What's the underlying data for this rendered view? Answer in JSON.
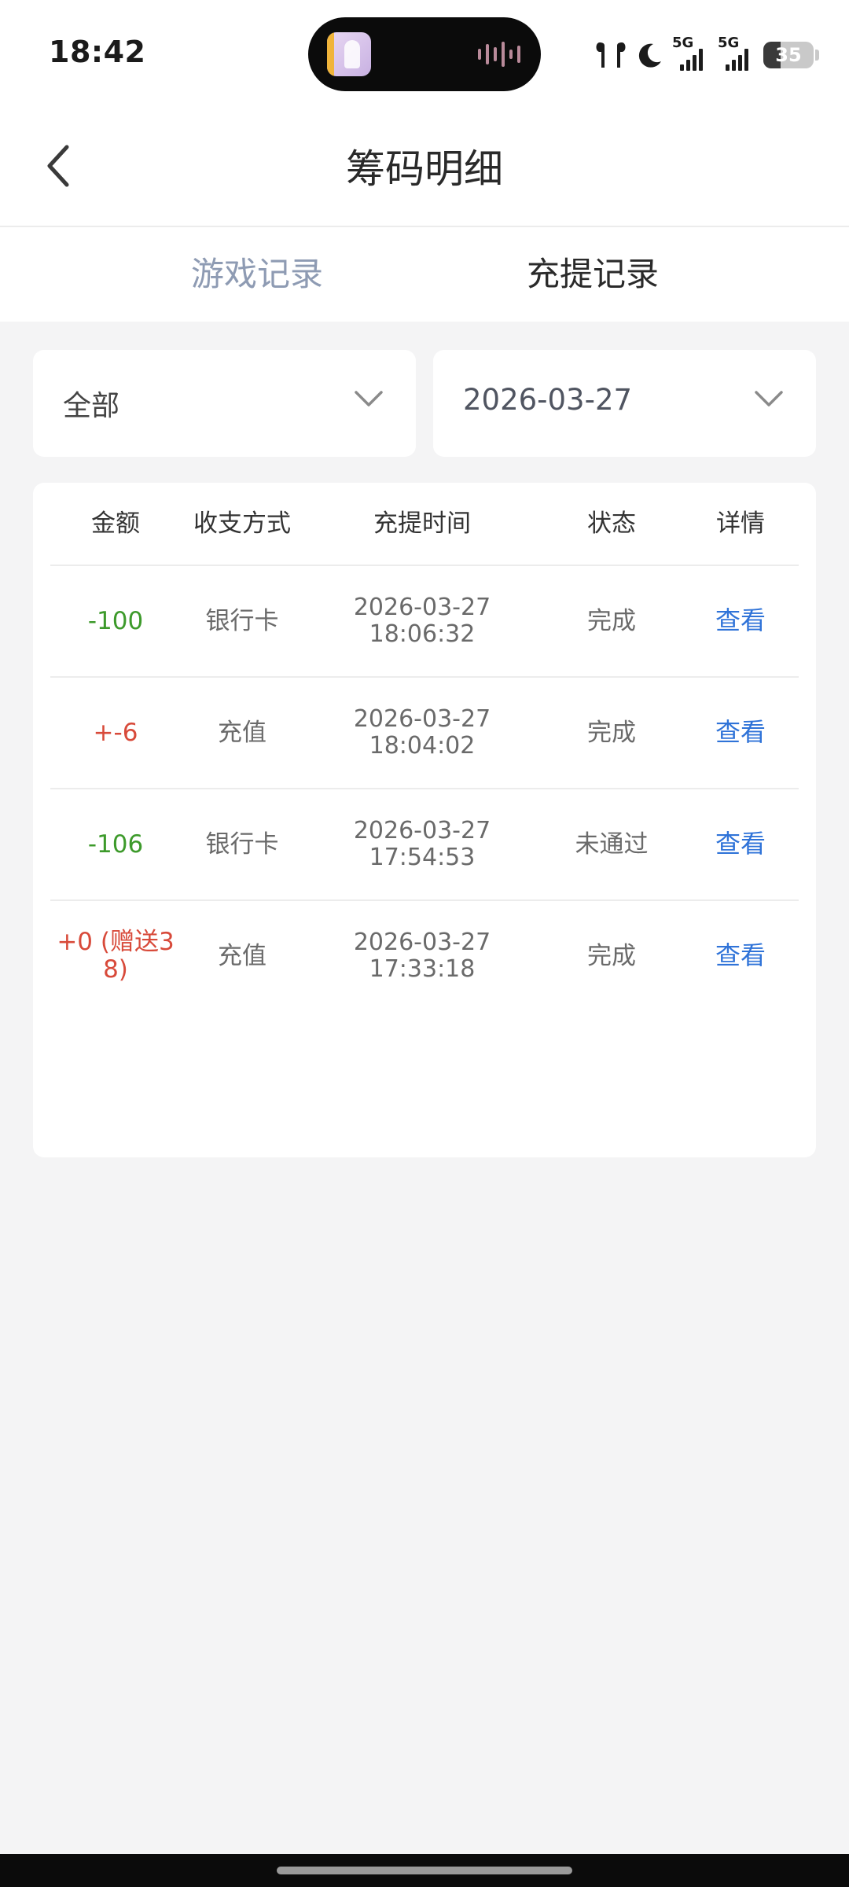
{
  "status_bar": {
    "time": "18:42",
    "network_1": "5G",
    "network_2": "5G",
    "battery": "35",
    "battery_level": 0.35
  },
  "nav": {
    "title": "筹码明细"
  },
  "tabs": {
    "game": "游戏记录",
    "recharge": "充提记录",
    "active": "recharge"
  },
  "filters": {
    "type_value": "全部",
    "date_value": "2026-03-27"
  },
  "table": {
    "headers": {
      "amount": "金额",
      "method": "收支方式",
      "time": "充提时间",
      "status": "状态",
      "detail": "详情"
    },
    "rows": [
      {
        "amount": "-100",
        "amount_sign": "neg",
        "method": "银行卡",
        "date": "2026-03-27",
        "time": "18:06:32",
        "status": "完成",
        "detail": "查看"
      },
      {
        "amount": "+-6",
        "amount_sign": "pos",
        "method": "充值",
        "date": "2026-03-27",
        "time": "18:04:02",
        "status": "完成",
        "detail": "查看"
      },
      {
        "amount": "-106",
        "amount_sign": "neg",
        "method": "银行卡",
        "date": "2026-03-27",
        "time": "17:54:53",
        "status": "未通过",
        "detail": "查看"
      },
      {
        "amount_line1": "+0 (赠送3",
        "amount_line2": "8)",
        "amount_sign": "pos",
        "method": "充值",
        "date": "2026-03-27",
        "time": "17:33:18",
        "status": "完成",
        "detail": "查看"
      }
    ]
  },
  "colors": {
    "negative_amount": "#3d9a2b",
    "positive_amount": "#d84a3a",
    "link": "#2f73d8",
    "inactive_tab": "#8e9bb3",
    "page_background": "#f4f4f5"
  }
}
